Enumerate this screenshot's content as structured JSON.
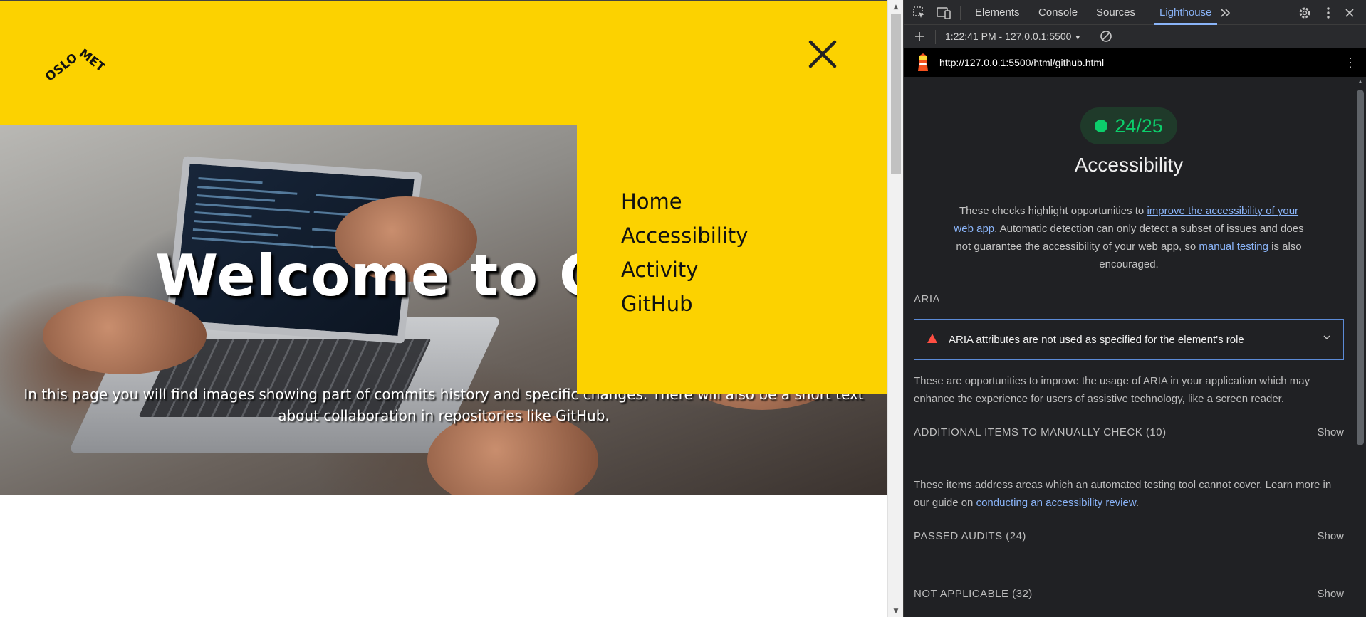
{
  "webpage": {
    "logo_text": "OSLOMET",
    "hero": {
      "title": "Welcome to G",
      "text": "In this page you will find images showing part of commits history and specific changes. There will also be a short text about collaboration in repositories like GitHub."
    },
    "nav": {
      "items": [
        {
          "label": "Home"
        },
        {
          "label": "Accessibility"
        },
        {
          "label": "Activity"
        },
        {
          "label": "GitHub"
        }
      ]
    },
    "colors": {
      "header": "#fcd200",
      "nav_bg": "#fcd200"
    }
  },
  "devtools": {
    "tabs": [
      {
        "label": "Elements"
      },
      {
        "label": "Console"
      },
      {
        "label": "Sources"
      },
      {
        "label": "Lighthouse",
        "active": true
      }
    ],
    "icons": [
      "inspect-element-icon",
      "device-toolbar-icon",
      "more-tabs-icon",
      "settings-icon",
      "more-options-icon",
      "close-icon",
      "add-icon",
      "clear-icon"
    ],
    "toolbar": {
      "report_select": "1:22:41 PM - 127.0.0.1:5500"
    },
    "report_url": "http://127.0.0.1:5500/html/github.html",
    "report": {
      "score": "24/25",
      "score_color": "#0cce6b",
      "category_title": "Accessibility",
      "desc_pre": "These checks highlight opportunities to ",
      "desc_link1": "improve the accessibility of your web app",
      "desc_mid": ". Automatic detection can only detect a subset of issues and does not guarantee the accessibility of your web app, so ",
      "desc_link2": "manual testing",
      "desc_post": " is also encouraged.",
      "groups": {
        "aria": {
          "title": "ARIA",
          "audit_title": "ARIA attributes are not used as specified for the element's role",
          "description": "These are opportunities to improve the usage of ARIA in your application which may enhance the experience for users of assistive technology, like a screen reader."
        },
        "manual": {
          "title": "ADDITIONAL ITEMS TO MANUALLY CHECK (10)",
          "toggle": "Show",
          "desc_pre": "These items address areas which an automated testing tool cannot cover. Learn more in our guide on ",
          "desc_link": "conducting an accessibility review",
          "desc_post": "."
        },
        "passed": {
          "title": "PASSED AUDITS (24)",
          "toggle": "Show"
        },
        "not_applicable": {
          "title": "NOT APPLICABLE (32)",
          "toggle": "Show"
        }
      }
    }
  }
}
